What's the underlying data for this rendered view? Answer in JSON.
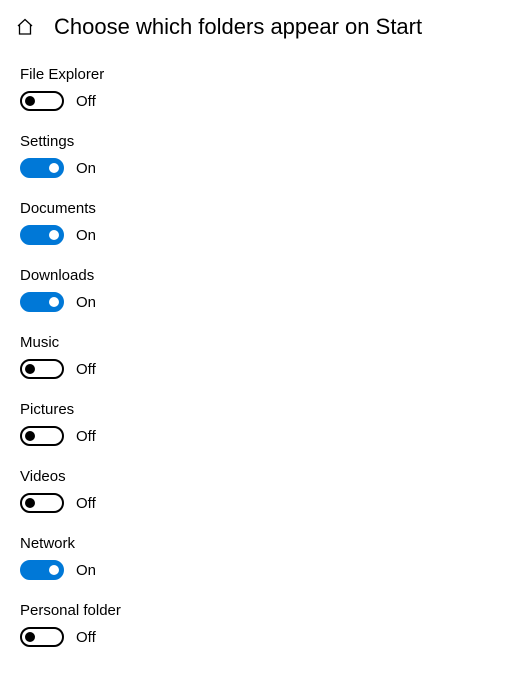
{
  "header": {
    "title": "Choose which folders appear on Start"
  },
  "labels": {
    "on": "On",
    "off": "Off"
  },
  "settings": [
    {
      "id": "file-explorer",
      "label": "File Explorer",
      "on": false
    },
    {
      "id": "settings",
      "label": "Settings",
      "on": true
    },
    {
      "id": "documents",
      "label": "Documents",
      "on": true
    },
    {
      "id": "downloads",
      "label": "Downloads",
      "on": true
    },
    {
      "id": "music",
      "label": "Music",
      "on": false
    },
    {
      "id": "pictures",
      "label": "Pictures",
      "on": false
    },
    {
      "id": "videos",
      "label": "Videos",
      "on": false
    },
    {
      "id": "network",
      "label": "Network",
      "on": true
    },
    {
      "id": "personal-folder",
      "label": "Personal folder",
      "on": false
    }
  ]
}
